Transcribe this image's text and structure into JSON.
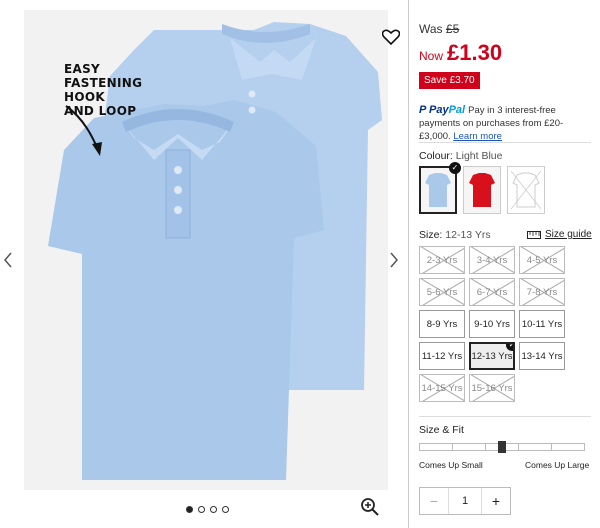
{
  "product": {
    "annotation": [
      "EASY",
      "FASTENING",
      "HOOK",
      "AND LOOP"
    ],
    "images": {
      "count": 4,
      "active": 1
    }
  },
  "price": {
    "was_label": "Was",
    "was_value": "£5",
    "now_label": "Now",
    "now_value": "£1.30",
    "save_badge": "Save £3.70"
  },
  "paypal": {
    "brand_a": "Pay",
    "brand_b": "Pal",
    "text": "Pay in 3 interest-free payments on purchases from £20-£3,000.",
    "link": "Learn more"
  },
  "colour": {
    "label": "Colour:",
    "selected": "Light Blue",
    "options": [
      "light-blue",
      "red",
      "white"
    ],
    "colors": {
      "light_blue": "#a9c8ea",
      "red": "#d8101c",
      "white": "#ffffff"
    }
  },
  "size": {
    "label": "Size:",
    "selected": "12-13 Yrs",
    "guide": "Size guide",
    "options": [
      {
        "label": "2-3 Yrs",
        "available": false
      },
      {
        "label": "3-4 Yrs",
        "available": false
      },
      {
        "label": "4-5 Yrs",
        "available": false
      },
      {
        "label": "5-6 Yrs",
        "available": false
      },
      {
        "label": "6-7 Yrs",
        "available": false
      },
      {
        "label": "7-8 Yrs",
        "available": false
      },
      {
        "label": "8-9 Yrs",
        "available": true
      },
      {
        "label": "9-10 Yrs",
        "available": true
      },
      {
        "label": "10-11 Yrs",
        "available": true
      },
      {
        "label": "11-12 Yrs",
        "available": true
      },
      {
        "label": "12-13 Yrs",
        "available": true
      },
      {
        "label": "13-14 Yrs",
        "available": true
      },
      {
        "label": "14-15 Yrs",
        "available": false
      },
      {
        "label": "15-16 Yrs",
        "available": false
      }
    ]
  },
  "fit": {
    "label": "Size & Fit",
    "small_label": "Comes Up Small",
    "large_label": "Comes Up Large",
    "segments": 5,
    "value": 0.5
  },
  "quantity": {
    "minus": "−",
    "value": "1",
    "plus": "+"
  },
  "brand_colors": {
    "accent_red": "#d0021b",
    "link_blue": "#1a55b8"
  }
}
